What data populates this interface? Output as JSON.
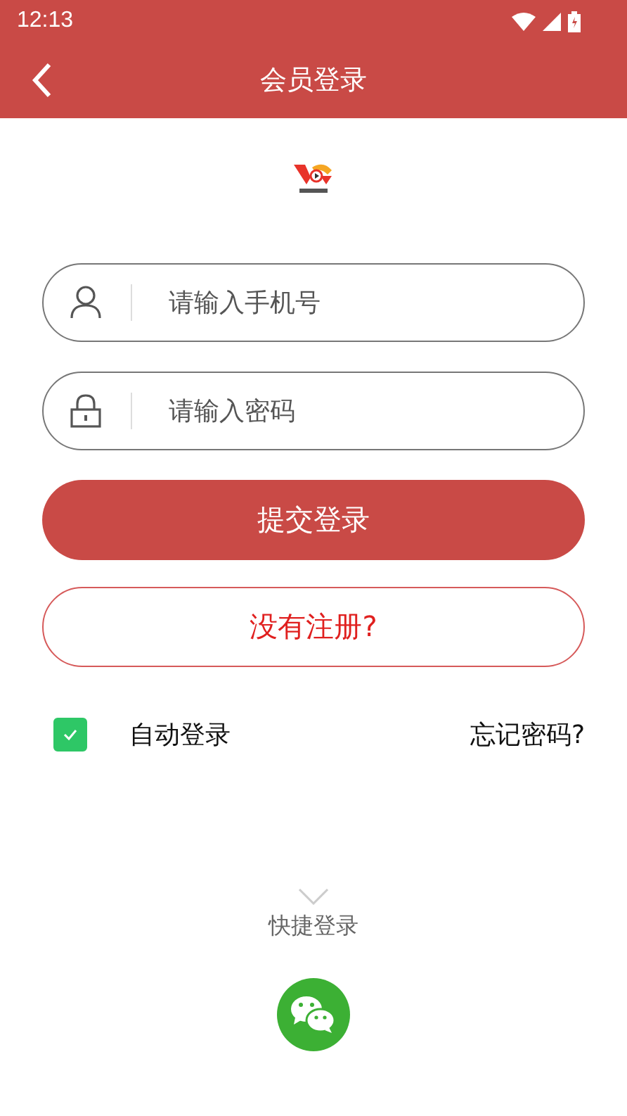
{
  "status_bar": {
    "time": "12:13"
  },
  "header": {
    "title": "会员登录"
  },
  "form": {
    "fields": [
      {
        "kind": "user",
        "placeholder": "请输入手机号"
      },
      {
        "kind": "lock",
        "placeholder": "请输入密码"
      }
    ],
    "submit": "提交登录",
    "register": "没有注册?"
  },
  "options": {
    "auto_login": {
      "label": "自动登录",
      "checked": true
    },
    "forgot": "忘记密码?"
  },
  "quick_login": {
    "label": "快捷登录"
  }
}
